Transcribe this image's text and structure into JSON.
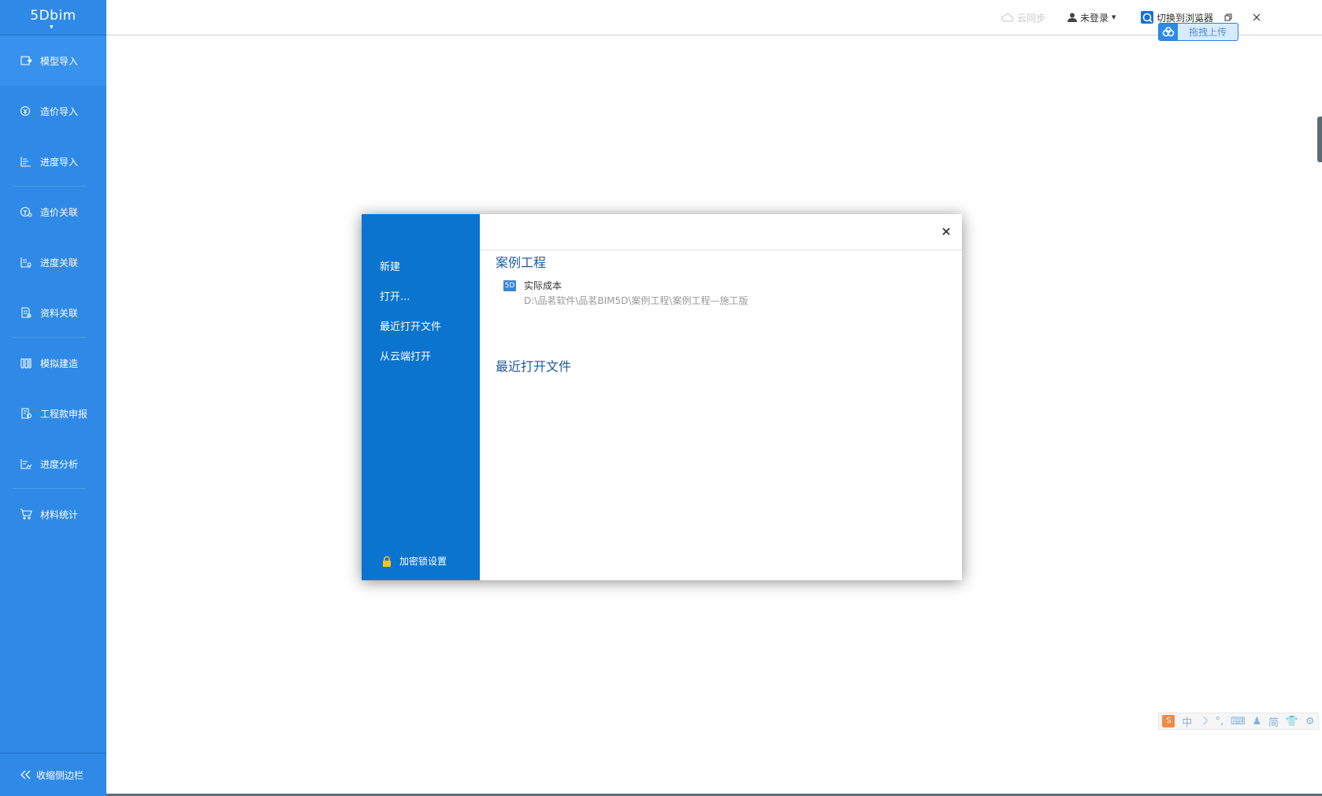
{
  "app": {
    "logo": "5Dbim"
  },
  "sidebar": {
    "items": [
      {
        "label": "模型导入",
        "icon": "model-import-icon"
      },
      {
        "label": "造价导入",
        "icon": "cost-import-icon"
      },
      {
        "label": "进度导入",
        "icon": "schedule-import-icon"
      },
      {
        "label": "造价关联",
        "icon": "cost-link-icon"
      },
      {
        "label": "进度关联",
        "icon": "schedule-link-icon"
      },
      {
        "label": "资料关联",
        "icon": "document-link-icon"
      },
      {
        "label": "模拟建造",
        "icon": "simulation-icon"
      },
      {
        "label": "工程款申报",
        "icon": "payment-report-icon"
      },
      {
        "label": "进度分析",
        "icon": "schedule-analysis-icon"
      },
      {
        "label": "材料统计",
        "icon": "cart-icon"
      }
    ],
    "collapse_label": "收缩侧边栏"
  },
  "topbar": {
    "cloud_sync": "云同步",
    "login": "未登录",
    "switch_browser": "切换到浏览器",
    "upload": "拖拽上传"
  },
  "dialog": {
    "menu": [
      "新建",
      "打开...",
      "最近打开文件",
      "从云端打开"
    ],
    "lock_settings": "加密锁设置",
    "sample_section": "案例工程",
    "sample_file": {
      "icon_text": "5D",
      "name": "实际成本",
      "path": "D:\\品茗软件\\品茗BIM5D\\案例工程\\案例工程—施工版"
    },
    "recent_section": "最近打开文件"
  },
  "ime": {
    "logo": "S",
    "mode": "中",
    "simplified": "简"
  },
  "colors": {
    "sidebar_bg": "#2e8ae6",
    "dialog_left_bg": "#0a74cf",
    "title_blue": "#1e5a97"
  }
}
